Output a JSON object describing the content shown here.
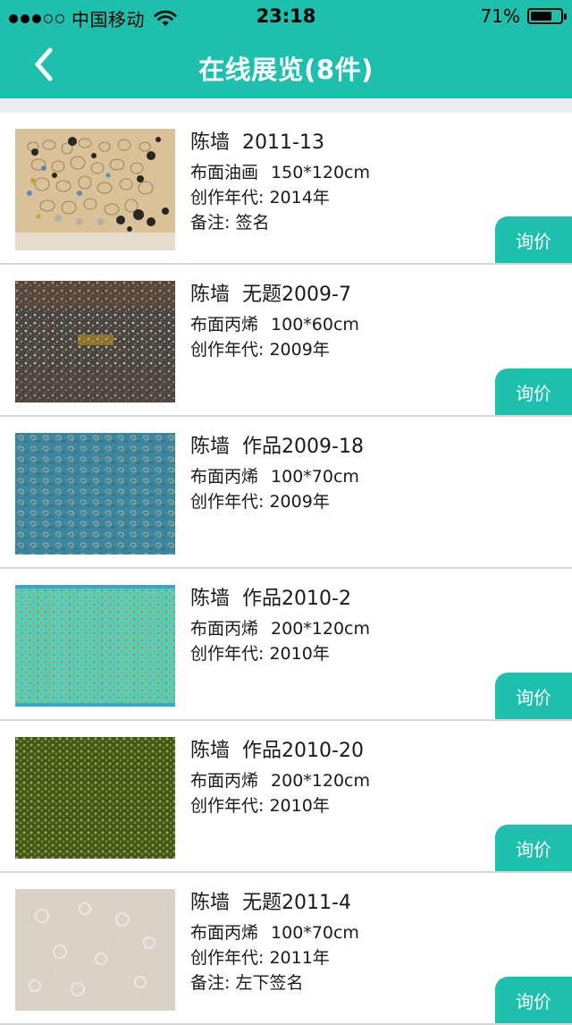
{
  "status_bar": {
    "carrier": "中国移动",
    "time": "23:18",
    "battery_text": "71%",
    "battery_level": 0.71,
    "signal_bars_filled": 3,
    "signal_bars_total": 5
  },
  "nav": {
    "back_icon": "chevron-left-icon",
    "title": "在线展览(8件)"
  },
  "colors": {
    "accent": "#1ec0ad",
    "divider": "#d6d6d6",
    "band": "#ececf0"
  },
  "items": [
    {
      "artist": "陈墙",
      "title": "2011-13",
      "medium": "布面油画",
      "size": "150*120cm",
      "year": "创作年代: 2014年",
      "note": "备注: 签名",
      "button": "询价"
    },
    {
      "artist": "陈墙",
      "title": "无题2009-7",
      "medium": "布面丙烯",
      "size": "100*60cm",
      "year": "创作年代: 2009年",
      "button": "询价"
    },
    {
      "artist": "陈墙",
      "title": "作品2009-18",
      "medium": "布面丙烯",
      "size": "100*70cm",
      "year": "创作年代: 2009年",
      "button": "询价"
    },
    {
      "artist": "陈墙",
      "title": "作品2010-2",
      "medium": "布面丙烯",
      "size": "200*120cm",
      "year": "创作年代: 2010年",
      "button": "询价"
    },
    {
      "artist": "陈墙",
      "title": "作品2010-20",
      "medium": "布面丙烯",
      "size": "200*120cm",
      "year": "创作年代: 2010年",
      "button": "询价"
    },
    {
      "artist": "陈墙",
      "title": "无题2011-4",
      "medium": "布面丙烯",
      "size": "100*70cm",
      "year": "创作年代: 2011年",
      "note": "备注: 左下签名",
      "button": "询价"
    }
  ]
}
